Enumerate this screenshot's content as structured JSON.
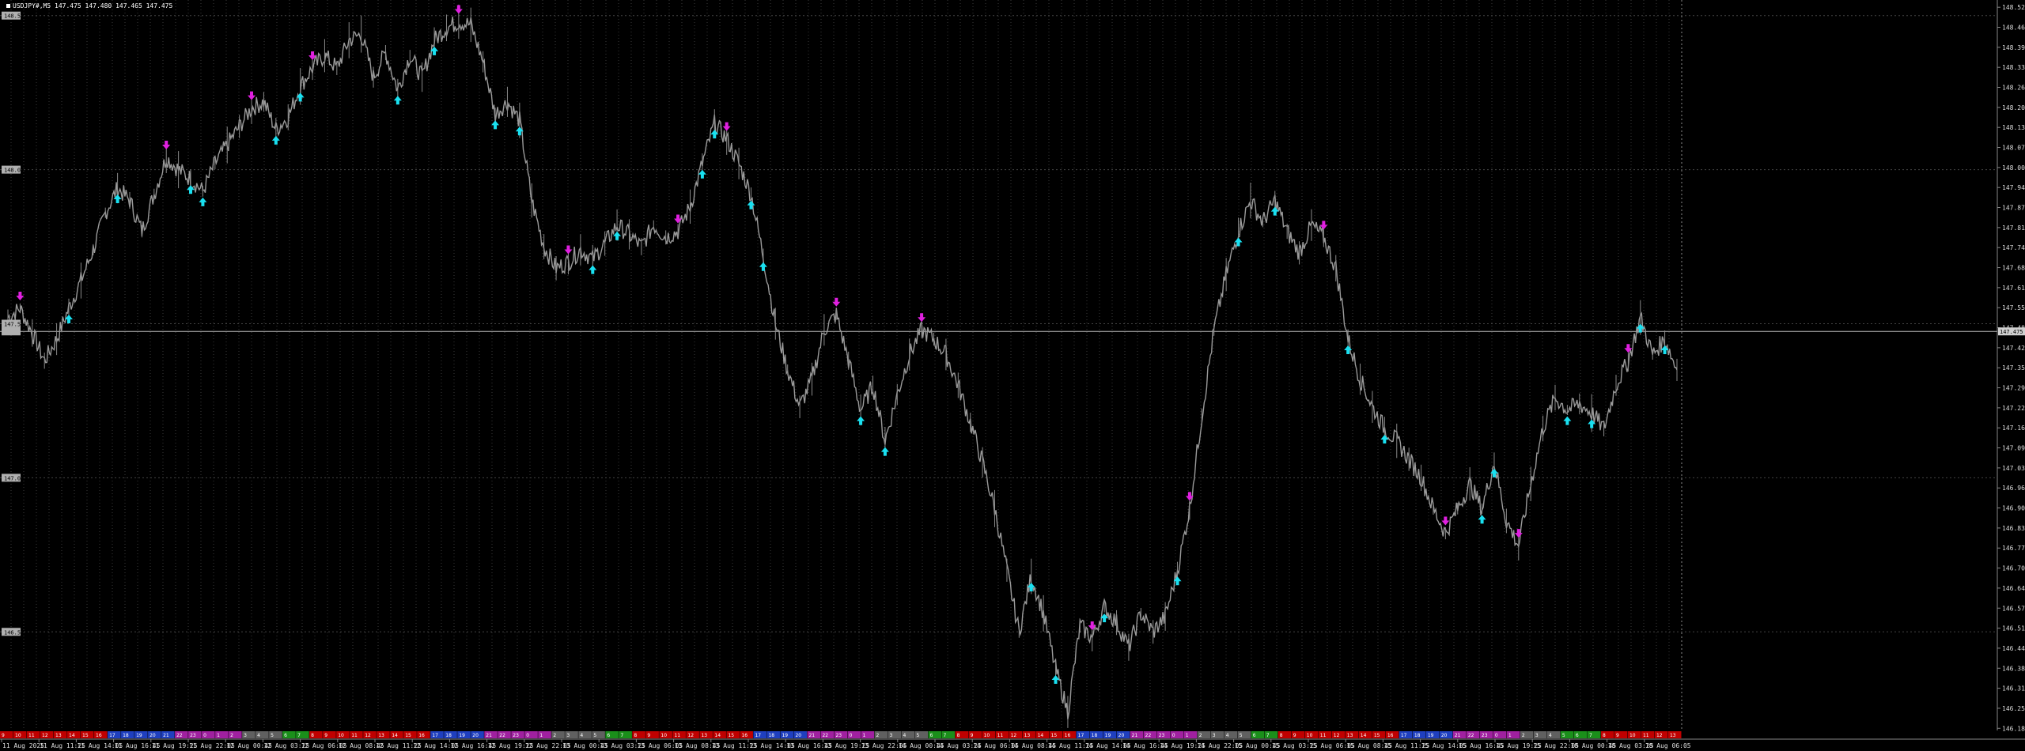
{
  "symbol": {
    "name": "USDJPY#,M5",
    "prices": "147.475 147.480 147.465 147.475"
  },
  "price_axis": {
    "labels": [
      "146.187",
      "146.252",
      "146.317",
      "146.382",
      "146.447",
      "146.512",
      "146.577",
      "146.642",
      "146.707",
      "146.772",
      "146.837",
      "146.902",
      "146.967",
      "147.032",
      "147.097",
      "147.162",
      "147.227",
      "147.292",
      "147.357",
      "147.422",
      "147.487",
      "147.552",
      "147.617",
      "147.682",
      "147.747",
      "147.812",
      "147.877",
      "147.942",
      "148.007",
      "148.072",
      "148.137",
      "148.202",
      "148.267",
      "148.332",
      "148.397",
      "148.462",
      "148.527"
    ],
    "current_price": "147.475",
    "left_level_labels": [
      "148.5",
      "148.0",
      "147.5",
      "147.0",
      "146.5"
    ]
  },
  "time_axis": {
    "labels": [
      "11 Aug 2025",
      "11 Aug 11:25",
      "11 Aug 14:05",
      "11 Aug 16:45",
      "11 Aug 19:25",
      "11 Aug 22:05",
      "12 Aug 00:45",
      "12 Aug 03:25",
      "12 Aug 06:05",
      "12 Aug 08:45",
      "12 Aug 11:25",
      "12 Aug 14:05",
      "12 Aug 16:45",
      "12 Aug 19:25",
      "12 Aug 22:05",
      "13 Aug 00:45",
      "13 Aug 03:25",
      "13 Aug 06:05",
      "13 Aug 08:45",
      "13 Aug 11:25",
      "13 Aug 14:05",
      "13 Aug 16:45",
      "13 Aug 19:25",
      "13 Aug 22:05",
      "14 Aug 00:45",
      "14 Aug 03:25",
      "14 Aug 06:05",
      "14 Aug 08:45",
      "14 Aug 11:25",
      "14 Aug 14:05",
      "14 Aug 16:45",
      "14 Aug 19:25",
      "14 Aug 22:05",
      "15 Aug 00:45",
      "15 Aug 03:25",
      "15 Aug 06:05",
      "15 Aug 08:45",
      "15 Aug 11:25",
      "15 Aug 14:05",
      "15 Aug 16:45",
      "15 Aug 19:25",
      "15 Aug 22:05",
      "18 Aug 00:45",
      "18 Aug 03:25",
      "18 Aug 06:05"
    ]
  },
  "session_strip": [
    [
      "9",
      "#c00000"
    ],
    [
      "10",
      "#c00000"
    ],
    [
      "11",
      "#c00000"
    ],
    [
      "12",
      "#c00000"
    ],
    [
      "13",
      "#c00000"
    ],
    [
      "14",
      "#c00000"
    ],
    [
      "15",
      "#c00000"
    ],
    [
      "16",
      "#c00000"
    ],
    [
      "17",
      "#1f3fbf"
    ],
    [
      "18",
      "#1f3fbf"
    ],
    [
      "19",
      "#1f3fbf"
    ],
    [
      "20",
      "#1f3fbf"
    ],
    [
      "21",
      "#1f3fbf"
    ],
    [
      "22",
      "#a020a0"
    ],
    [
      "23",
      "#a020a0"
    ],
    [
      "0",
      "#a020a0"
    ],
    [
      "1",
      "#a020a0"
    ],
    [
      "2",
      "#a020a0"
    ],
    [
      "3",
      "#606060"
    ],
    [
      "4",
      "#606060"
    ],
    [
      "5",
      "#606060"
    ],
    [
      "6",
      "#1a8f1a"
    ],
    [
      "7",
      "#1a8f1a"
    ],
    [
      "8",
      "#c00000"
    ],
    [
      "9",
      "#c00000"
    ],
    [
      "10",
      "#c00000"
    ],
    [
      "11",
      "#c00000"
    ],
    [
      "12",
      "#c00000"
    ],
    [
      "13",
      "#c00000"
    ],
    [
      "14",
      "#c00000"
    ],
    [
      "15",
      "#c00000"
    ],
    [
      "16",
      "#c00000"
    ],
    [
      "17",
      "#1f3fbf"
    ],
    [
      "18",
      "#1f3fbf"
    ],
    [
      "19",
      "#1f3fbf"
    ],
    [
      "20",
      "#1f3fbf"
    ],
    [
      "21",
      "#a020a0"
    ],
    [
      "22",
      "#a020a0"
    ],
    [
      "23",
      "#a020a0"
    ],
    [
      "0",
      "#a020a0"
    ],
    [
      "1",
      "#a020a0"
    ],
    [
      "2",
      "#606060"
    ],
    [
      "3",
      "#606060"
    ],
    [
      "4",
      "#606060"
    ],
    [
      "5",
      "#606060"
    ],
    [
      "6",
      "#1a8f1a"
    ],
    [
      "7",
      "#1a8f1a"
    ],
    [
      "8",
      "#c00000"
    ],
    [
      "9",
      "#c00000"
    ],
    [
      "10",
      "#c00000"
    ],
    [
      "11",
      "#c00000"
    ],
    [
      "12",
      "#c00000"
    ],
    [
      "13",
      "#c00000"
    ],
    [
      "14",
      "#c00000"
    ],
    [
      "15",
      "#c00000"
    ],
    [
      "16",
      "#c00000"
    ],
    [
      "17",
      "#1f3fbf"
    ],
    [
      "18",
      "#1f3fbf"
    ],
    [
      "19",
      "#1f3fbf"
    ],
    [
      "20",
      "#1f3fbf"
    ],
    [
      "21",
      "#a020a0"
    ],
    [
      "22",
      "#a020a0"
    ],
    [
      "23",
      "#a020a0"
    ],
    [
      "0",
      "#a020a0"
    ],
    [
      "1",
      "#a020a0"
    ],
    [
      "2",
      "#606060"
    ],
    [
      "3",
      "#606060"
    ],
    [
      "4",
      "#606060"
    ],
    [
      "5",
      "#606060"
    ],
    [
      "6",
      "#1a8f1a"
    ],
    [
      "7",
      "#1a8f1a"
    ],
    [
      "8",
      "#c00000"
    ],
    [
      "9",
      "#c00000"
    ],
    [
      "10",
      "#c00000"
    ],
    [
      "11",
      "#c00000"
    ],
    [
      "12",
      "#c00000"
    ],
    [
      "13",
      "#c00000"
    ],
    [
      "14",
      "#c00000"
    ],
    [
      "15",
      "#c00000"
    ],
    [
      "16",
      "#c00000"
    ],
    [
      "17",
      "#1f3fbf"
    ],
    [
      "18",
      "#1f3fbf"
    ],
    [
      "19",
      "#1f3fbf"
    ],
    [
      "20",
      "#1f3fbf"
    ],
    [
      "21",
      "#a020a0"
    ],
    [
      "22",
      "#a020a0"
    ],
    [
      "23",
      "#a020a0"
    ],
    [
      "0",
      "#a020a0"
    ],
    [
      "1",
      "#a020a0"
    ],
    [
      "2",
      "#606060"
    ],
    [
      "3",
      "#606060"
    ],
    [
      "4",
      "#606060"
    ],
    [
      "5",
      "#606060"
    ],
    [
      "6",
      "#1a8f1a"
    ],
    [
      "7",
      "#1a8f1a"
    ],
    [
      "8",
      "#c00000"
    ],
    [
      "9",
      "#c00000"
    ],
    [
      "10",
      "#c00000"
    ],
    [
      "11",
      "#c00000"
    ],
    [
      "12",
      "#c00000"
    ],
    [
      "13",
      "#c00000"
    ],
    [
      "14",
      "#c00000"
    ],
    [
      "15",
      "#c00000"
    ],
    [
      "16",
      "#c00000"
    ],
    [
      "17",
      "#1f3fbf"
    ],
    [
      "18",
      "#1f3fbf"
    ],
    [
      "19",
      "#1f3fbf"
    ],
    [
      "20",
      "#1f3fbf"
    ],
    [
      "21",
      "#a020a0"
    ],
    [
      "22",
      "#a020a0"
    ],
    [
      "23",
      "#a020a0"
    ],
    [
      "0",
      "#a020a0"
    ],
    [
      "1",
      "#a020a0"
    ],
    [
      "2",
      "#606060"
    ],
    [
      "3",
      "#606060"
    ],
    [
      "4",
      "#606060"
    ],
    [
      "5",
      "#1a8f1a"
    ],
    [
      "6",
      "#1a8f1a"
    ],
    [
      "7",
      "#1a8f1a"
    ],
    [
      "8",
      "#c00000"
    ],
    [
      "9",
      "#c00000"
    ],
    [
      "10",
      "#c00000"
    ],
    [
      "11",
      "#c00000"
    ],
    [
      "12",
      "#c00000"
    ],
    [
      "13",
      "#c00000"
    ]
  ],
  "chart_data": {
    "type": "line",
    "series": [
      {
        "values": [
          147.52,
          147.55,
          147.47,
          147.38,
          147.45,
          147.55,
          147.64,
          147.74,
          147.86,
          147.94,
          147.9,
          147.8,
          147.92,
          148.04,
          148.0,
          147.97,
          147.93,
          148.02,
          148.08,
          148.14,
          148.2,
          148.22,
          148.13,
          148.17,
          148.27,
          148.33,
          148.37,
          148.33,
          148.42,
          148.44,
          148.3,
          148.38,
          148.26,
          148.37,
          148.3,
          148.42,
          148.46,
          148.48,
          148.47,
          148.35,
          148.18,
          148.22,
          148.16,
          147.9,
          147.75,
          147.68,
          147.7,
          147.74,
          147.71,
          147.76,
          147.82,
          147.79,
          147.75,
          147.82,
          147.78,
          147.8,
          147.88,
          148.02,
          148.15,
          148.1,
          148.02,
          147.92,
          147.72,
          147.5,
          147.35,
          147.23,
          147.32,
          147.48,
          147.53,
          147.38,
          147.22,
          147.3,
          147.12,
          147.27,
          147.4,
          147.48,
          147.45,
          147.4,
          147.3,
          147.18,
          147.05,
          146.9,
          146.7,
          146.5,
          146.68,
          146.56,
          146.38,
          146.24,
          146.52,
          146.48,
          146.58,
          146.53,
          146.45,
          146.56,
          146.5,
          146.55,
          146.7,
          146.9,
          147.2,
          147.48,
          147.66,
          147.8,
          147.9,
          147.83,
          147.9,
          147.8,
          147.73,
          147.82,
          147.78,
          147.68,
          147.45,
          147.32,
          147.23,
          147.16,
          147.12,
          147.06,
          147.0,
          146.9,
          146.82,
          146.9,
          146.98,
          146.9,
          147.05,
          146.86,
          146.78,
          146.98,
          147.16,
          147.26,
          147.22,
          147.24,
          147.21,
          147.16,
          147.3,
          147.38,
          147.52,
          147.4,
          147.45,
          147.35
        ]
      }
    ],
    "ylim": [
      146.18,
      148.53
    ],
    "grid": true,
    "current_price": 147.475
  }
}
